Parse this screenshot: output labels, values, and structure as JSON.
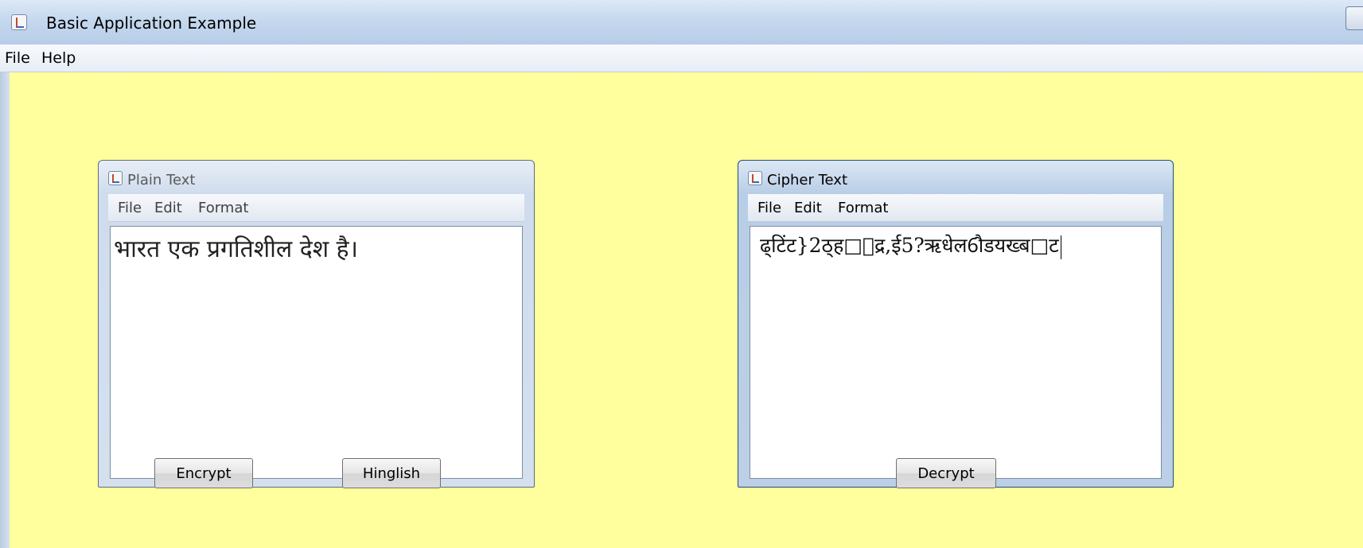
{
  "window": {
    "title": "Basic Application Example"
  },
  "menubar": {
    "items": [
      "File",
      "Help"
    ]
  },
  "plain_frame": {
    "title": "Plain Text",
    "menu": [
      "File",
      "Edit",
      "Format"
    ],
    "text": "भारत एक प्रगतिशील देश है।"
  },
  "cipher_frame": {
    "title": "Cipher Text",
    "menu": [
      "File",
      "Edit",
      "Format"
    ],
    "text": "ढ्टिंट}2ठ्ह□ाद्र,ई5?ऋधेल6ौडयख्ब□ट"
  },
  "buttons": {
    "encrypt": "Encrypt",
    "hinglish": "Hinglish",
    "decrypt": "Decrypt"
  },
  "colors": {
    "desktop": "#ffff9e",
    "titlebar": "#c5d8ee",
    "textarea": "#ffffff"
  }
}
